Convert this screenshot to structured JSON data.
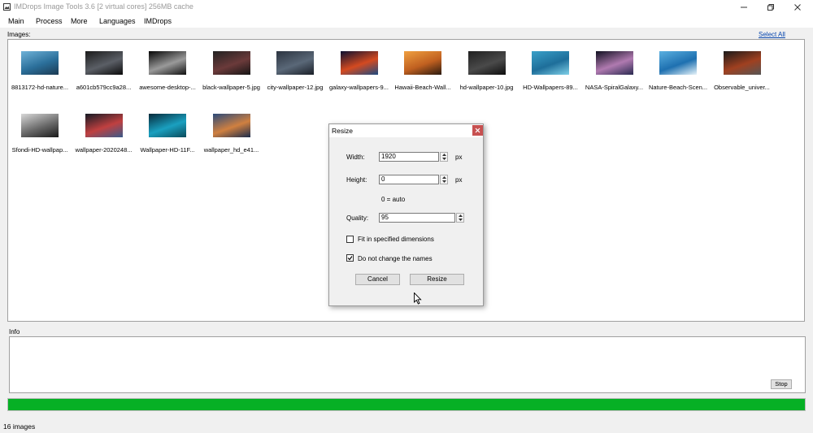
{
  "window": {
    "title": "IMDrops Image Tools 3.6 [2 virtual cores] 256MB cache"
  },
  "menu": [
    "Main",
    "Process",
    "More",
    "Languages",
    "IMDrops"
  ],
  "images_label": "Images:",
  "select_all": "Select All",
  "images": [
    {
      "label": "8813172-hd-nature...",
      "colors": [
        "#6fb2d8",
        "#2b6f9a",
        "#1c3a52"
      ]
    },
    {
      "label": "a601cb579cc9a28...",
      "colors": [
        "#1b1b1b",
        "#5b5f66",
        "#0a0a0a"
      ]
    },
    {
      "label": "awesome-desktop-...",
      "colors": [
        "#050505",
        "#9a9a9a",
        "#101010"
      ]
    },
    {
      "label": "black-wallpaper-5.jpg",
      "colors": [
        "#222222",
        "#6b3a3a",
        "#151515"
      ]
    },
    {
      "label": "city-wallpaper-12.jpg",
      "colors": [
        "#2c3440",
        "#5a6878",
        "#1a1f27"
      ]
    },
    {
      "label": "galaxy-wallpapers-9...",
      "colors": [
        "#0b1030",
        "#d44a20",
        "#1c4a80"
      ]
    },
    {
      "label": "Hawaii-Beach-Wall...",
      "colors": [
        "#f0a040",
        "#c06020",
        "#2a1a10"
      ]
    },
    {
      "label": "hd-wallpaper-10.jpg",
      "colors": [
        "#202020",
        "#4a4a4a",
        "#0e0e0e"
      ]
    },
    {
      "label": "HD-Wallpapers-89...",
      "colors": [
        "#3aa0c8",
        "#1e6e9a",
        "#7fd0e8"
      ]
    },
    {
      "label": "NASA-SpiralGalaxy...",
      "colors": [
        "#101020",
        "#b07ab0",
        "#2a2a50"
      ]
    },
    {
      "label": "Nature-Beach-Scen...",
      "colors": [
        "#5ab0e0",
        "#1e70b0",
        "#e8f4fa"
      ]
    },
    {
      "label": "Observable_univer...",
      "colors": [
        "#1a1a1a",
        "#a04020",
        "#555555"
      ]
    },
    {
      "label": "Sfondi-HD-wallpap...",
      "colors": [
        "#d8d8d8",
        "#6a6a6a",
        "#1a1a1a"
      ]
    },
    {
      "label": "wallpaper-2020248...",
      "colors": [
        "#141a24",
        "#c04040",
        "#3a5a8a"
      ]
    },
    {
      "label": "Wallpaper-HD-11F...",
      "colors": [
        "#062a3a",
        "#1aa0c0",
        "#0a4a5a"
      ]
    },
    {
      "label": "wallpaper_hd_e41...",
      "colors": [
        "#2a4a7a",
        "#d08040",
        "#1a2a4a"
      ]
    }
  ],
  "info_label": "Info",
  "stop_label": "Stop",
  "progress": {
    "percent": 100,
    "color": "#06b025"
  },
  "status": "16 images",
  "dialog": {
    "title": "Resize",
    "width_label": "Width:",
    "width_value": "1920",
    "height_label": "Height:",
    "height_value": "0",
    "unit": "px",
    "auto_hint": "0 = auto",
    "quality_label": "Quality:",
    "quality_value": "95",
    "fit_label": "Fit in specified dimensions",
    "fit_checked": false,
    "names_label": "Do not change the names",
    "names_checked": true,
    "cancel_label": "Cancel",
    "resize_label": "Resize"
  }
}
